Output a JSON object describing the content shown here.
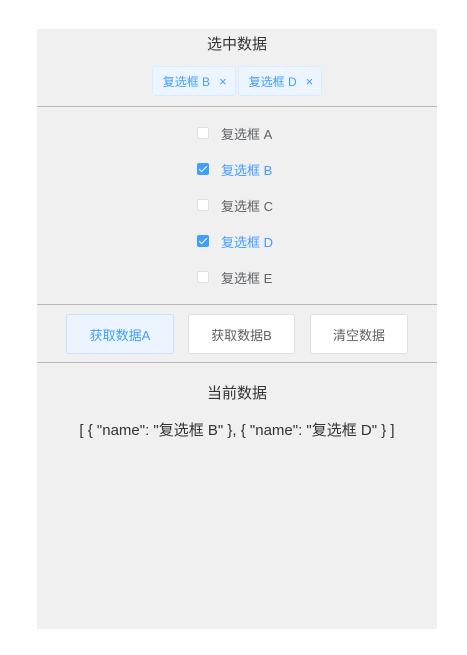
{
  "selected": {
    "title": "选中数据",
    "tags": [
      {
        "label": "复选框 B",
        "close": "×"
      },
      {
        "label": "复选框 D",
        "close": "×"
      }
    ]
  },
  "checkboxes": [
    {
      "label": "复选框 A",
      "checked": false
    },
    {
      "label": "复选框 B",
      "checked": true
    },
    {
      "label": "复选框 C",
      "checked": false
    },
    {
      "label": "复选框 D",
      "checked": true
    },
    {
      "label": "复选框 E",
      "checked": false
    }
  ],
  "buttons": {
    "get_a": "获取数据A",
    "get_b": "获取数据B",
    "clear": "清空数据"
  },
  "current": {
    "title": "当前数据",
    "value": "[ { \"name\": \"复选框 B\" }, { \"name\": \"复选框 D\" } ]"
  },
  "colors": {
    "accent": "#409eff",
    "panel_bg": "#f0f0f0"
  }
}
